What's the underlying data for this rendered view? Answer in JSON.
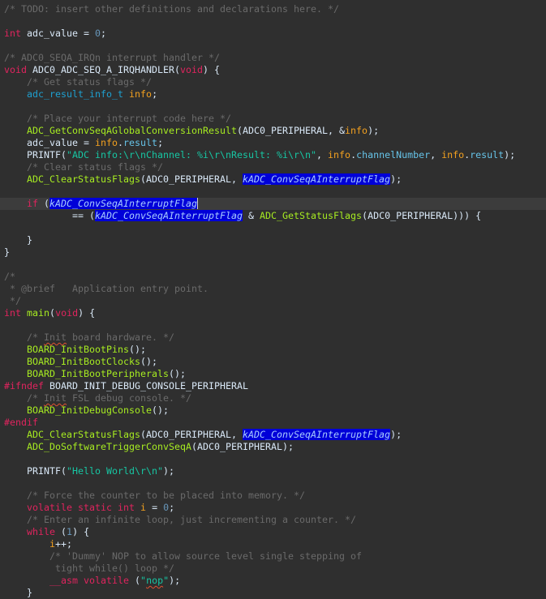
{
  "editor": {
    "current_line": 16,
    "lines": [
      [
        [
          "c",
          "/* TODO: insert other definitions and declarations here. */"
        ]
      ],
      [],
      [
        [
          "k",
          "int"
        ],
        [
          "p",
          " adc_value = "
        ],
        [
          "n",
          "0"
        ],
        [
          "p",
          ";"
        ]
      ],
      [],
      [
        [
          "c",
          "/* ADC0_SEQA_IRQn interrupt handler */"
        ]
      ],
      [
        [
          "k",
          "void"
        ],
        [
          "p",
          " ADC0_ADC_SEQ_A_IRQHANDLER("
        ],
        [
          "k",
          "void"
        ],
        [
          "p",
          ") {"
        ]
      ],
      [
        [
          "p",
          "    "
        ],
        [
          "c",
          "/* Get status flags */"
        ]
      ],
      [
        [
          "p",
          "    "
        ],
        [
          "t",
          "adc_result_info_t"
        ],
        [
          "p",
          " "
        ],
        [
          "v",
          "info"
        ],
        [
          "p",
          ";"
        ]
      ],
      [],
      [
        [
          "p",
          "    "
        ],
        [
          "c",
          "/* Place your interrupt code here */"
        ]
      ],
      [
        [
          "p",
          "    "
        ],
        [
          "f",
          "ADC_GetConvSeqAGlobalConversionResult"
        ],
        [
          "p",
          "(ADC0_PERIPHERAL, &"
        ],
        [
          "v",
          "info"
        ],
        [
          "p",
          ");"
        ]
      ],
      [
        [
          "p",
          "    adc_value = "
        ],
        [
          "v",
          "info"
        ],
        [
          "p",
          "."
        ],
        [
          "fld",
          "result"
        ],
        [
          "p",
          ";"
        ]
      ],
      [
        [
          "p",
          "    PRINTF("
        ],
        [
          "s",
          "\"ADC info:\\r\\nChannel: %i\\r\\nResult: %i\\r\\n\""
        ],
        [
          "p",
          ", "
        ],
        [
          "v",
          "info"
        ],
        [
          "p",
          "."
        ],
        [
          "fld",
          "channelNumber"
        ],
        [
          "p",
          ", "
        ],
        [
          "v",
          "info"
        ],
        [
          "p",
          "."
        ],
        [
          "fld",
          "result"
        ],
        [
          "p",
          ");"
        ]
      ],
      [
        [
          "p",
          "    "
        ],
        [
          "c",
          "/* Clear status flags */"
        ]
      ],
      [
        [
          "p",
          "    "
        ],
        [
          "f",
          "ADC_ClearStatusFlags"
        ],
        [
          "p",
          "(ADC0_PERIPHERAL, "
        ],
        [
          "sel",
          "kADC_ConvSeqAInterruptFlag"
        ],
        [
          "p",
          ");"
        ]
      ],
      [],
      [
        [
          "p",
          "    "
        ],
        [
          "k",
          "if"
        ],
        [
          "p",
          " ("
        ],
        [
          "sel caret",
          "kADC_ConvSeqAInterruptFlag"
        ]
      ],
      [
        [
          "p",
          "            == ("
        ],
        [
          "sel",
          "kADC_ConvSeqAInterruptFlag"
        ],
        [
          "p",
          " & "
        ],
        [
          "f",
          "ADC_GetStatusFlags"
        ],
        [
          "p",
          "(ADC0_PERIPHERAL))) {"
        ]
      ],
      [],
      [
        [
          "p",
          "    }"
        ]
      ],
      [
        [
          "p",
          "}"
        ]
      ],
      [],
      [
        [
          "c",
          "/*"
        ]
      ],
      [
        [
          "c",
          " * @brief   Application entry point."
        ]
      ],
      [
        [
          "c",
          " */"
        ]
      ],
      [
        [
          "k",
          "int"
        ],
        [
          "p",
          " "
        ],
        [
          "f",
          "main"
        ],
        [
          "p",
          "("
        ],
        [
          "k",
          "void"
        ],
        [
          "p",
          ") {"
        ]
      ],
      [],
      [
        [
          "p",
          "    "
        ],
        [
          "c",
          "/* "
        ],
        [
          "c sq",
          "Init"
        ],
        [
          "c",
          " board hardware. */"
        ]
      ],
      [
        [
          "p",
          "    "
        ],
        [
          "f",
          "BOARD_InitBootPins"
        ],
        [
          "p",
          "();"
        ]
      ],
      [
        [
          "p",
          "    "
        ],
        [
          "f",
          "BOARD_InitBootClocks"
        ],
        [
          "p",
          "();"
        ]
      ],
      [
        [
          "p",
          "    "
        ],
        [
          "f",
          "BOARD_InitBootPeripherals"
        ],
        [
          "p",
          "();"
        ]
      ],
      [
        [
          "k",
          "#ifndef"
        ],
        [
          "p",
          " BOARD_INIT_DEBUG_CONSOLE_PERIPHERAL"
        ]
      ],
      [
        [
          "p",
          "    "
        ],
        [
          "c",
          "/* "
        ],
        [
          "c sq",
          "Init"
        ],
        [
          "c",
          " FSL debug console. */"
        ]
      ],
      [
        [
          "p",
          "    "
        ],
        [
          "f",
          "BOARD_InitDebugConsole"
        ],
        [
          "p",
          "();"
        ]
      ],
      [
        [
          "k",
          "#endif"
        ]
      ],
      [
        [
          "p",
          "    "
        ],
        [
          "f",
          "ADC_ClearStatusFlags"
        ],
        [
          "p",
          "(ADC0_PERIPHERAL, "
        ],
        [
          "sel",
          "kADC_ConvSeqAInterruptFlag"
        ],
        [
          "p",
          ");"
        ]
      ],
      [
        [
          "p",
          "    "
        ],
        [
          "f",
          "ADC_DoSoftwareTriggerConvSeqA"
        ],
        [
          "p",
          "(ADC0_PERIPHERAL);"
        ]
      ],
      [],
      [
        [
          "p",
          "    PRINTF("
        ],
        [
          "s",
          "\"Hello World\\r\\n\""
        ],
        [
          "p",
          ");"
        ]
      ],
      [],
      [
        [
          "p",
          "    "
        ],
        [
          "c",
          "/* Force the counter to be placed into memory. */"
        ]
      ],
      [
        [
          "p",
          "    "
        ],
        [
          "k",
          "volatile static int"
        ],
        [
          "p",
          " "
        ],
        [
          "v",
          "i"
        ],
        [
          "p",
          " = "
        ],
        [
          "n",
          "0"
        ],
        [
          "p",
          ";"
        ]
      ],
      [
        [
          "p",
          "    "
        ],
        [
          "c",
          "/* Enter an infinite loop, just incrementing a counter. */"
        ]
      ],
      [
        [
          "p",
          "    "
        ],
        [
          "k",
          "while"
        ],
        [
          "p",
          " ("
        ],
        [
          "n",
          "1"
        ],
        [
          "p",
          ") {"
        ]
      ],
      [
        [
          "p",
          "        "
        ],
        [
          "v",
          "i"
        ],
        [
          "p",
          "++;"
        ]
      ],
      [
        [
          "p",
          "        "
        ],
        [
          "c",
          "/* 'Dummy' NOP to allow source level single stepping of"
        ]
      ],
      [
        [
          "p",
          "         "
        ],
        [
          "c",
          "tight while() loop */"
        ]
      ],
      [
        [
          "p",
          "        "
        ],
        [
          "k",
          "__asm volatile"
        ],
        [
          "p",
          " ("
        ],
        [
          "s",
          "\""
        ],
        [
          "s sq",
          "nop"
        ],
        [
          "s",
          "\""
        ],
        [
          "p",
          ");"
        ]
      ],
      [
        [
          "p",
          "    }"
        ]
      ]
    ]
  },
  "colors": {
    "background": "#2f2f2f",
    "keyword": "#e0245e",
    "function": "#a7ec21",
    "comment": "#6a6a6a",
    "selection": "#0000d8"
  }
}
